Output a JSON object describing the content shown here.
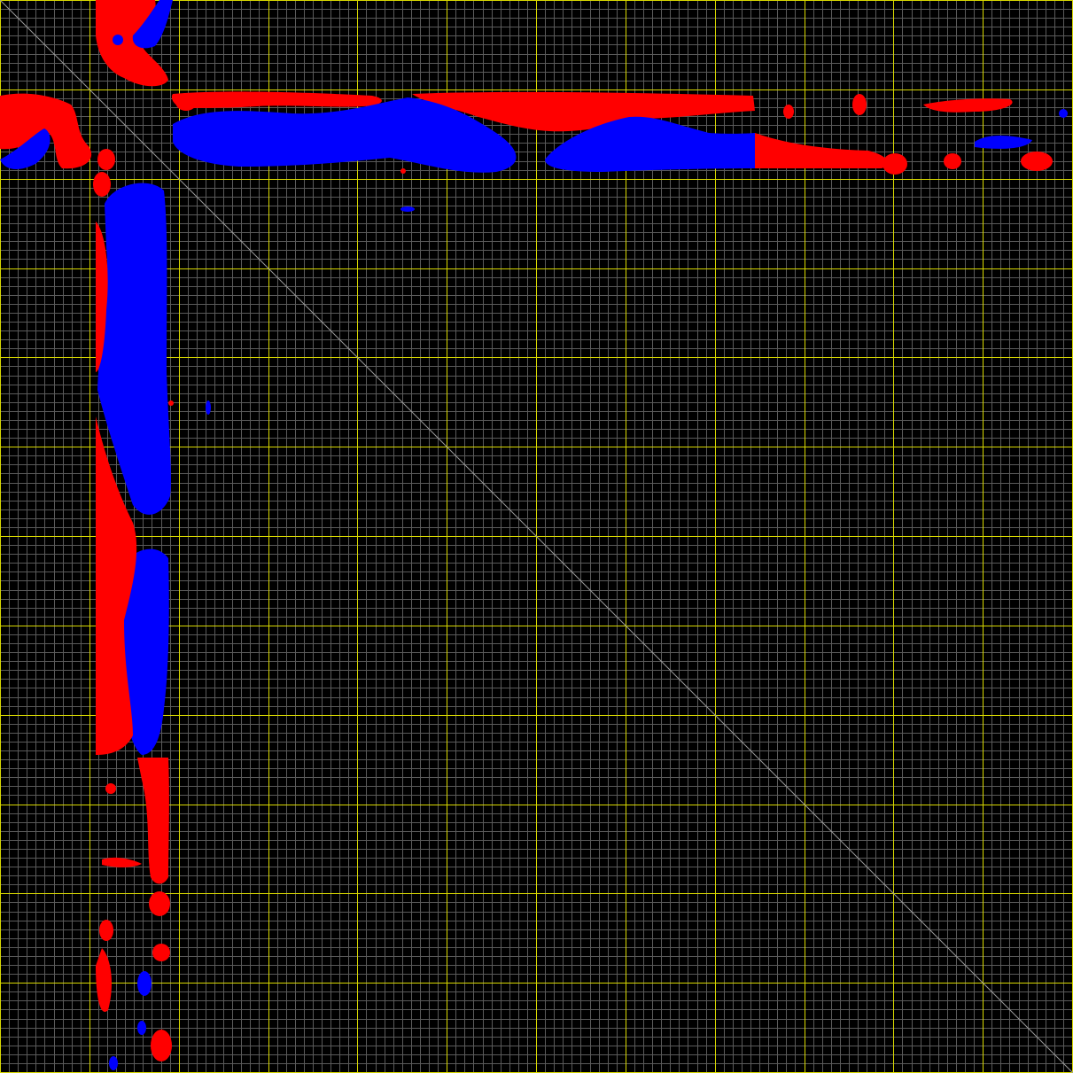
{
  "colors": {
    "background": "#000000",
    "minor_grid": "#5a5a5a",
    "major_grid": "#d8d800",
    "diagonal": "#9a9a9a",
    "positive": "#ff0000",
    "negative": "#0000ff"
  },
  "grid": {
    "minor_divisions": 120,
    "major_divisions": 12,
    "diagonal": true
  },
  "icons": {
    "plot": "contour-map-icon"
  }
}
